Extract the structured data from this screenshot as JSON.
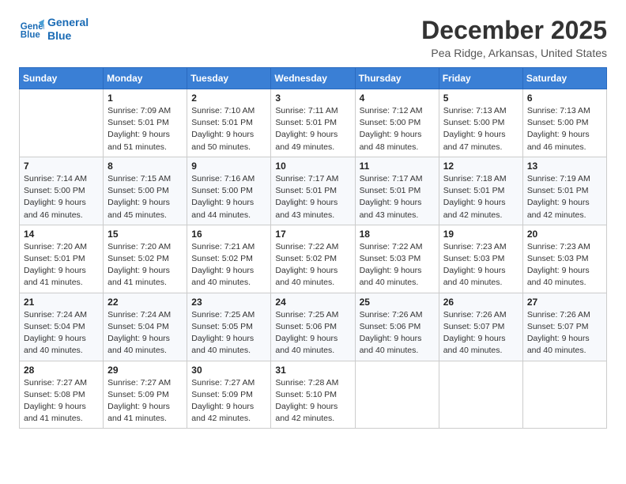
{
  "header": {
    "logo_line1": "General",
    "logo_line2": "Blue",
    "month": "December 2025",
    "location": "Pea Ridge, Arkansas, United States"
  },
  "weekdays": [
    "Sunday",
    "Monday",
    "Tuesday",
    "Wednesday",
    "Thursday",
    "Friday",
    "Saturday"
  ],
  "weeks": [
    [
      {
        "day": "",
        "info": ""
      },
      {
        "day": "1",
        "info": "Sunrise: 7:09 AM\nSunset: 5:01 PM\nDaylight: 9 hours\nand 51 minutes."
      },
      {
        "day": "2",
        "info": "Sunrise: 7:10 AM\nSunset: 5:01 PM\nDaylight: 9 hours\nand 50 minutes."
      },
      {
        "day": "3",
        "info": "Sunrise: 7:11 AM\nSunset: 5:01 PM\nDaylight: 9 hours\nand 49 minutes."
      },
      {
        "day": "4",
        "info": "Sunrise: 7:12 AM\nSunset: 5:00 PM\nDaylight: 9 hours\nand 48 minutes."
      },
      {
        "day": "5",
        "info": "Sunrise: 7:13 AM\nSunset: 5:00 PM\nDaylight: 9 hours\nand 47 minutes."
      },
      {
        "day": "6",
        "info": "Sunrise: 7:13 AM\nSunset: 5:00 PM\nDaylight: 9 hours\nand 46 minutes."
      }
    ],
    [
      {
        "day": "7",
        "info": "Sunrise: 7:14 AM\nSunset: 5:00 PM\nDaylight: 9 hours\nand 46 minutes."
      },
      {
        "day": "8",
        "info": "Sunrise: 7:15 AM\nSunset: 5:00 PM\nDaylight: 9 hours\nand 45 minutes."
      },
      {
        "day": "9",
        "info": "Sunrise: 7:16 AM\nSunset: 5:00 PM\nDaylight: 9 hours\nand 44 minutes."
      },
      {
        "day": "10",
        "info": "Sunrise: 7:17 AM\nSunset: 5:01 PM\nDaylight: 9 hours\nand 43 minutes."
      },
      {
        "day": "11",
        "info": "Sunrise: 7:17 AM\nSunset: 5:01 PM\nDaylight: 9 hours\nand 43 minutes."
      },
      {
        "day": "12",
        "info": "Sunrise: 7:18 AM\nSunset: 5:01 PM\nDaylight: 9 hours\nand 42 minutes."
      },
      {
        "day": "13",
        "info": "Sunrise: 7:19 AM\nSunset: 5:01 PM\nDaylight: 9 hours\nand 42 minutes."
      }
    ],
    [
      {
        "day": "14",
        "info": "Sunrise: 7:20 AM\nSunset: 5:01 PM\nDaylight: 9 hours\nand 41 minutes."
      },
      {
        "day": "15",
        "info": "Sunrise: 7:20 AM\nSunset: 5:02 PM\nDaylight: 9 hours\nand 41 minutes."
      },
      {
        "day": "16",
        "info": "Sunrise: 7:21 AM\nSunset: 5:02 PM\nDaylight: 9 hours\nand 40 minutes."
      },
      {
        "day": "17",
        "info": "Sunrise: 7:22 AM\nSunset: 5:02 PM\nDaylight: 9 hours\nand 40 minutes."
      },
      {
        "day": "18",
        "info": "Sunrise: 7:22 AM\nSunset: 5:03 PM\nDaylight: 9 hours\nand 40 minutes."
      },
      {
        "day": "19",
        "info": "Sunrise: 7:23 AM\nSunset: 5:03 PM\nDaylight: 9 hours\nand 40 minutes."
      },
      {
        "day": "20",
        "info": "Sunrise: 7:23 AM\nSunset: 5:03 PM\nDaylight: 9 hours\nand 40 minutes."
      }
    ],
    [
      {
        "day": "21",
        "info": "Sunrise: 7:24 AM\nSunset: 5:04 PM\nDaylight: 9 hours\nand 40 minutes."
      },
      {
        "day": "22",
        "info": "Sunrise: 7:24 AM\nSunset: 5:04 PM\nDaylight: 9 hours\nand 40 minutes."
      },
      {
        "day": "23",
        "info": "Sunrise: 7:25 AM\nSunset: 5:05 PM\nDaylight: 9 hours\nand 40 minutes."
      },
      {
        "day": "24",
        "info": "Sunrise: 7:25 AM\nSunset: 5:06 PM\nDaylight: 9 hours\nand 40 minutes."
      },
      {
        "day": "25",
        "info": "Sunrise: 7:26 AM\nSunset: 5:06 PM\nDaylight: 9 hours\nand 40 minutes."
      },
      {
        "day": "26",
        "info": "Sunrise: 7:26 AM\nSunset: 5:07 PM\nDaylight: 9 hours\nand 40 minutes."
      },
      {
        "day": "27",
        "info": "Sunrise: 7:26 AM\nSunset: 5:07 PM\nDaylight: 9 hours\nand 40 minutes."
      }
    ],
    [
      {
        "day": "28",
        "info": "Sunrise: 7:27 AM\nSunset: 5:08 PM\nDaylight: 9 hours\nand 41 minutes."
      },
      {
        "day": "29",
        "info": "Sunrise: 7:27 AM\nSunset: 5:09 PM\nDaylight: 9 hours\nand 41 minutes."
      },
      {
        "day": "30",
        "info": "Sunrise: 7:27 AM\nSunset: 5:09 PM\nDaylight: 9 hours\nand 42 minutes."
      },
      {
        "day": "31",
        "info": "Sunrise: 7:28 AM\nSunset: 5:10 PM\nDaylight: 9 hours\nand 42 minutes."
      },
      {
        "day": "",
        "info": ""
      },
      {
        "day": "",
        "info": ""
      },
      {
        "day": "",
        "info": ""
      }
    ]
  ]
}
